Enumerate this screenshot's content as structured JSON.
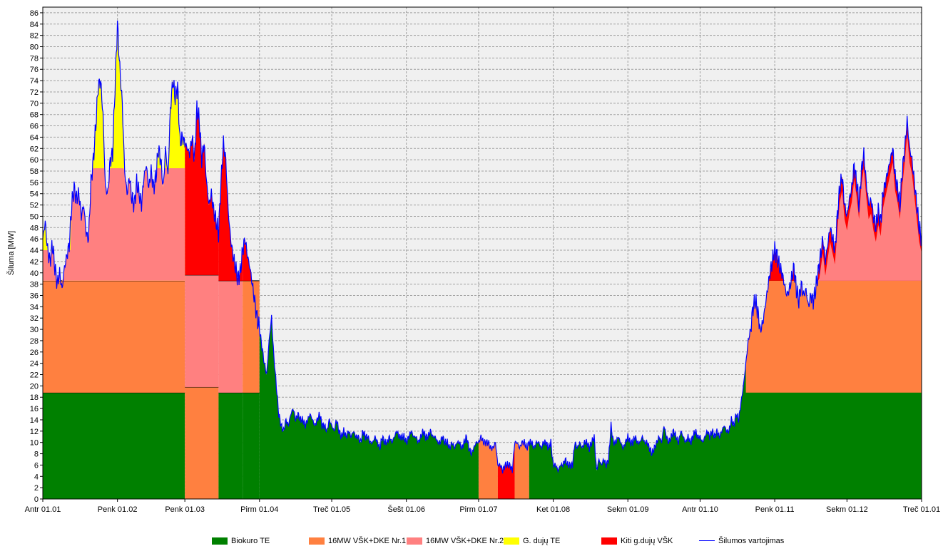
{
  "chart_data": {
    "type": "area",
    "ylabel": "Šiluma [MW]",
    "xlabel": "",
    "ylim": [
      0,
      87
    ],
    "yticks": [
      0,
      2,
      4,
      6,
      8,
      10,
      12,
      14,
      16,
      18,
      20,
      22,
      24,
      26,
      28,
      30,
      32,
      34,
      36,
      38,
      40,
      42,
      44,
      46,
      48,
      50,
      52,
      54,
      56,
      58,
      60,
      62,
      64,
      66,
      68,
      70,
      72,
      74,
      76,
      78,
      80,
      82,
      84,
      86
    ],
    "xticks": [
      "Antr 01.01",
      "Penk 01.02",
      "Penk 01.03",
      "Pirm 01.04",
      "Treč 01.05",
      "Šešt 01.06",
      "Pirm 01.07",
      "Ket 01.08",
      "Sekm 01.09",
      "Antr 01.10",
      "Penk 01.11",
      "Sekm 01.12",
      "Treč 01.01"
    ],
    "x_days": [
      0,
      31,
      59,
      90,
      120,
      151,
      181,
      212,
      243,
      273,
      304,
      334,
      365
    ],
    "grid": true,
    "background": "#f0f0f0",
    "legend_position": "bottom",
    "colors": {
      "biokuro": "#008000",
      "vsk1": "#ff8040",
      "vsk2": "#ff8080",
      "gduju": "#ffff00",
      "kiti": "#ff0000",
      "vartojimas": "#0000ff"
    },
    "series": [
      {
        "key": "biokuro",
        "name": "Biokuro TE",
        "kind": "stacked-area"
      },
      {
        "key": "vsk1",
        "name": "16MW VŠK+DKE Nr.1",
        "kind": "stacked-area"
      },
      {
        "key": "vsk2",
        "name": "16MW VŠK+DKE Nr.2",
        "kind": "stacked-area"
      },
      {
        "key": "gduju",
        "name": "G. dujų TE",
        "kind": "stacked-area"
      },
      {
        "key": "kiti",
        "name": "Kiti g.dujų VŠK",
        "kind": "stacked-area"
      },
      {
        "key": "vartojimas",
        "name": "Šilumos vartojimas",
        "kind": "line"
      }
    ],
    "segments": [
      {
        "x0": 0,
        "x1": 59,
        "biokuro": 18.8,
        "vsk1": 19.8
      },
      {
        "x0": 59,
        "x1": 73,
        "biokuro": 0,
        "vsk1": 19.8,
        "vsk2": 19.8
      },
      {
        "x0": 73,
        "x1": 83,
        "biokuro": 18.8,
        "vsk1": 0,
        "vsk2": 19.8
      },
      {
        "x0": 83,
        "x1": 90,
        "biokuro": 18.8,
        "vsk1": 19.8
      },
      {
        "x0": 90,
        "x1": 181,
        "biokuro": "demand"
      },
      {
        "x0": 181,
        "x1": 189,
        "vsk1": "demand"
      },
      {
        "x0": 189,
        "x1": 196,
        "kiti": "demand"
      },
      {
        "x0": 196,
        "x1": 202,
        "vsk1": "demand"
      },
      {
        "x0": 202,
        "x1": 365,
        "biokuro": "demand"
      }
    ],
    "demand_profile": [
      [
        0,
        46
      ],
      [
        1,
        49
      ],
      [
        2,
        44
      ],
      [
        3,
        42
      ],
      [
        4,
        45
      ],
      [
        5,
        41
      ],
      [
        6,
        38
      ],
      [
        7,
        40
      ],
      [
        8,
        37
      ],
      [
        9,
        41
      ],
      [
        10,
        43
      ],
      [
        11,
        45
      ],
      [
        12,
        52
      ],
      [
        13,
        55
      ],
      [
        14,
        53
      ],
      [
        15,
        54
      ],
      [
        16,
        50
      ],
      [
        17,
        52
      ],
      [
        18,
        47
      ],
      [
        19,
        46
      ],
      [
        20,
        56
      ],
      [
        21,
        60
      ],
      [
        22,
        66
      ],
      [
        23,
        73
      ],
      [
        24,
        74
      ],
      [
        25,
        68
      ],
      [
        26,
        55
      ],
      [
        27,
        54
      ],
      [
        28,
        60
      ],
      [
        29,
        61
      ],
      [
        30,
        73
      ],
      [
        31,
        84
      ],
      [
        32,
        76
      ],
      [
        33,
        70
      ],
      [
        34,
        58
      ],
      [
        35,
        54
      ],
      [
        36,
        57
      ],
      [
        37,
        53
      ],
      [
        38,
        52
      ],
      [
        39,
        56
      ],
      [
        40,
        54
      ],
      [
        41,
        52
      ],
      [
        42,
        57
      ],
      [
        43,
        59
      ],
      [
        44,
        55
      ],
      [
        45,
        58
      ],
      [
        46,
        55
      ],
      [
        47,
        57
      ],
      [
        48,
        62
      ],
      [
        49,
        60
      ],
      [
        50,
        55
      ],
      [
        51,
        62
      ],
      [
        52,
        57
      ],
      [
        53,
        69
      ],
      [
        54,
        74
      ],
      [
        55,
        71
      ],
      [
        56,
        73
      ],
      [
        57,
        63
      ],
      [
        58,
        64
      ],
      [
        59,
        63
      ],
      [
        60,
        62
      ],
      [
        61,
        61
      ],
      [
        62,
        64
      ],
      [
        63,
        60
      ],
      [
        64,
        69
      ],
      [
        65,
        67
      ],
      [
        66,
        60
      ],
      [
        67,
        63
      ],
      [
        68,
        56
      ],
      [
        69,
        52
      ],
      [
        70,
        54
      ],
      [
        71,
        51
      ],
      [
        72,
        49
      ],
      [
        73,
        47
      ],
      [
        74,
        56
      ],
      [
        75,
        63
      ],
      [
        76,
        60
      ],
      [
        77,
        51
      ],
      [
        78,
        46
      ],
      [
        79,
        43
      ],
      [
        80,
        41
      ],
      [
        81,
        39
      ],
      [
        82,
        40
      ],
      [
        83,
        44
      ],
      [
        84,
        46
      ],
      [
        85,
        43
      ],
      [
        86,
        41
      ],
      [
        87,
        38
      ],
      [
        88,
        35
      ],
      [
        89,
        32
      ],
      [
        90,
        30
      ],
      [
        91,
        27
      ],
      [
        92,
        24
      ],
      [
        93,
        22
      ],
      [
        94,
        28
      ],
      [
        95,
        32
      ],
      [
        96,
        25
      ],
      [
        97,
        20
      ],
      [
        98,
        15
      ],
      [
        99,
        13
      ],
      [
        100,
        12
      ],
      [
        101,
        14
      ],
      [
        102,
        13
      ],
      [
        103,
        15
      ],
      [
        104,
        16
      ],
      [
        105,
        14
      ],
      [
        106,
        15
      ],
      [
        107,
        14
      ],
      [
        108,
        14
      ],
      [
        109,
        13
      ],
      [
        110,
        14
      ],
      [
        111,
        15
      ],
      [
        112,
        14
      ],
      [
        113,
        13
      ],
      [
        114,
        14
      ],
      [
        115,
        15
      ],
      [
        116,
        13
      ],
      [
        117,
        13
      ],
      [
        118,
        12
      ],
      [
        119,
        14
      ],
      [
        120,
        13
      ],
      [
        121,
        12
      ],
      [
        122,
        14
      ],
      [
        123,
        12
      ],
      [
        124,
        11
      ],
      [
        125,
        12
      ],
      [
        126,
        11
      ],
      [
        127,
        12
      ],
      [
        128,
        11
      ],
      [
        129,
        12
      ],
      [
        130,
        11
      ],
      [
        131,
        11
      ],
      [
        132,
        10
      ],
      [
        133,
        12
      ],
      [
        134,
        11
      ],
      [
        135,
        11
      ],
      [
        136,
        10
      ],
      [
        137,
        10
      ],
      [
        138,
        11
      ],
      [
        139,
        10
      ],
      [
        140,
        9
      ],
      [
        141,
        11
      ],
      [
        142,
        10
      ],
      [
        143,
        10
      ],
      [
        144,
        11
      ],
      [
        145,
        10
      ],
      [
        146,
        11
      ],
      [
        147,
        12
      ],
      [
        148,
        11
      ],
      [
        149,
        11
      ],
      [
        150,
        11
      ],
      [
        151,
        10
      ],
      [
        152,
        11
      ],
      [
        153,
        12
      ],
      [
        154,
        11
      ],
      [
        155,
        11
      ],
      [
        156,
        10
      ],
      [
        157,
        11
      ],
      [
        158,
        12
      ],
      [
        159,
        11
      ],
      [
        160,
        11
      ],
      [
        161,
        12
      ],
      [
        162,
        11
      ],
      [
        163,
        11
      ],
      [
        164,
        10
      ],
      [
        165,
        10
      ],
      [
        166,
        11
      ],
      [
        167,
        10
      ],
      [
        168,
        10
      ],
      [
        169,
        9
      ],
      [
        170,
        10
      ],
      [
        171,
        9
      ],
      [
        172,
        10
      ],
      [
        173,
        10
      ],
      [
        174,
        9
      ],
      [
        175,
        10
      ],
      [
        176,
        11
      ],
      [
        177,
        9
      ],
      [
        178,
        8
      ],
      [
        179,
        9
      ],
      [
        180,
        10
      ],
      [
        181,
        10
      ],
      [
        182,
        11
      ],
      [
        183,
        10
      ],
      [
        184,
        10
      ],
      [
        185,
        10
      ],
      [
        186,
        9
      ],
      [
        187,
        9
      ],
      [
        188,
        10
      ],
      [
        189,
        6
      ],
      [
        190,
        6
      ],
      [
        191,
        5
      ],
      [
        192,
        6
      ],
      [
        193,
        6
      ],
      [
        194,
        6
      ],
      [
        195,
        5
      ],
      [
        196,
        10
      ],
      [
        197,
        10
      ],
      [
        198,
        9
      ],
      [
        199,
        10
      ],
      [
        200,
        10
      ],
      [
        201,
        9
      ],
      [
        202,
        10
      ],
      [
        203,
        10
      ],
      [
        204,
        9
      ],
      [
        205,
        10
      ],
      [
        206,
        10
      ],
      [
        207,
        9
      ],
      [
        208,
        10
      ],
      [
        209,
        10
      ],
      [
        210,
        9
      ],
      [
        211,
        10
      ],
      [
        212,
        6
      ],
      [
        213,
        6
      ],
      [
        214,
        5
      ],
      [
        215,
        6
      ],
      [
        216,
        6
      ],
      [
        217,
        7
      ],
      [
        218,
        6
      ],
      [
        219,
        6
      ],
      [
        220,
        6
      ],
      [
        221,
        10
      ],
      [
        222,
        9
      ],
      [
        223,
        10
      ],
      [
        224,
        9
      ],
      [
        225,
        10
      ],
      [
        226,
        10
      ],
      [
        227,
        9
      ],
      [
        228,
        10
      ],
      [
        229,
        11
      ],
      [
        230,
        5
      ],
      [
        231,
        7
      ],
      [
        232,
        6
      ],
      [
        233,
        7
      ],
      [
        234,
        6
      ],
      [
        235,
        7
      ],
      [
        236,
        13
      ],
      [
        237,
        10
      ],
      [
        238,
        10
      ],
      [
        239,
        11
      ],
      [
        240,
        10
      ],
      [
        241,
        9
      ],
      [
        242,
        10
      ],
      [
        243,
        11
      ],
      [
        244,
        10
      ],
      [
        245,
        10
      ],
      [
        246,
        11
      ],
      [
        247,
        10
      ],
      [
        248,
        10
      ],
      [
        249,
        11
      ],
      [
        250,
        10
      ],
      [
        251,
        10
      ],
      [
        252,
        9
      ],
      [
        253,
        8
      ],
      [
        254,
        9
      ],
      [
        255,
        10
      ],
      [
        256,
        11
      ],
      [
        257,
        10
      ],
      [
        258,
        13
      ],
      [
        259,
        11
      ],
      [
        260,
        10
      ],
      [
        261,
        11
      ],
      [
        262,
        12
      ],
      [
        263,
        11
      ],
      [
        264,
        10
      ],
      [
        265,
        12
      ],
      [
        266,
        11
      ],
      [
        267,
        10
      ],
      [
        268,
        11
      ],
      [
        269,
        10
      ],
      [
        270,
        11
      ],
      [
        271,
        12
      ],
      [
        272,
        11
      ],
      [
        273,
        11
      ],
      [
        274,
        10
      ],
      [
        275,
        11
      ],
      [
        276,
        12
      ],
      [
        277,
        11
      ],
      [
        278,
        12
      ],
      [
        279,
        11
      ],
      [
        280,
        12
      ],
      [
        281,
        11
      ],
      [
        282,
        12
      ],
      [
        283,
        13
      ],
      [
        284,
        12
      ],
      [
        285,
        12
      ],
      [
        286,
        14
      ],
      [
        287,
        13
      ],
      [
        288,
        15
      ],
      [
        289,
        14
      ],
      [
        290,
        17
      ],
      [
        291,
        20
      ],
      [
        292,
        24
      ],
      [
        293,
        28
      ],
      [
        294,
        30
      ],
      [
        295,
        34
      ],
      [
        296,
        35
      ],
      [
        297,
        33
      ],
      [
        298,
        30
      ],
      [
        299,
        31
      ],
      [
        300,
        34
      ],
      [
        301,
        37
      ],
      [
        302,
        40
      ],
      [
        303,
        42
      ],
      [
        304,
        44
      ],
      [
        305,
        43
      ],
      [
        306,
        41
      ],
      [
        307,
        40
      ],
      [
        308,
        38
      ],
      [
        309,
        36
      ],
      [
        310,
        37
      ],
      [
        311,
        39
      ],
      [
        312,
        41
      ],
      [
        313,
        37
      ],
      [
        314,
        35
      ],
      [
        315,
        38
      ],
      [
        316,
        36
      ],
      [
        317,
        37
      ],
      [
        318,
        34
      ],
      [
        319,
        36
      ],
      [
        320,
        35
      ],
      [
        321,
        37
      ],
      [
        322,
        40
      ],
      [
        323,
        43
      ],
      [
        324,
        46
      ],
      [
        325,
        42
      ],
      [
        326,
        45
      ],
      [
        327,
        48
      ],
      [
        328,
        46
      ],
      [
        329,
        44
      ],
      [
        330,
        50
      ],
      [
        331,
        55
      ],
      [
        332,
        57
      ],
      [
        333,
        52
      ],
      [
        334,
        50
      ],
      [
        335,
        53
      ],
      [
        336,
        55
      ],
      [
        337,
        59
      ],
      [
        338,
        56
      ],
      [
        339,
        52
      ],
      [
        340,
        58
      ],
      [
        341,
        61
      ],
      [
        342,
        56
      ],
      [
        343,
        52
      ],
      [
        344,
        53
      ],
      [
        345,
        50
      ],
      [
        346,
        48
      ],
      [
        347,
        51
      ],
      [
        348,
        49
      ],
      [
        349,
        54
      ],
      [
        350,
        56
      ],
      [
        351,
        58
      ],
      [
        352,
        60
      ],
      [
        353,
        62
      ],
      [
        354,
        57
      ],
      [
        355,
        55
      ],
      [
        356,
        52
      ],
      [
        357,
        58
      ],
      [
        358,
        62
      ],
      [
        359,
        67
      ],
      [
        360,
        62
      ],
      [
        361,
        60
      ],
      [
        362,
        56
      ],
      [
        363,
        52
      ],
      [
        364,
        48
      ],
      [
        365,
        46
      ]
    ]
  }
}
